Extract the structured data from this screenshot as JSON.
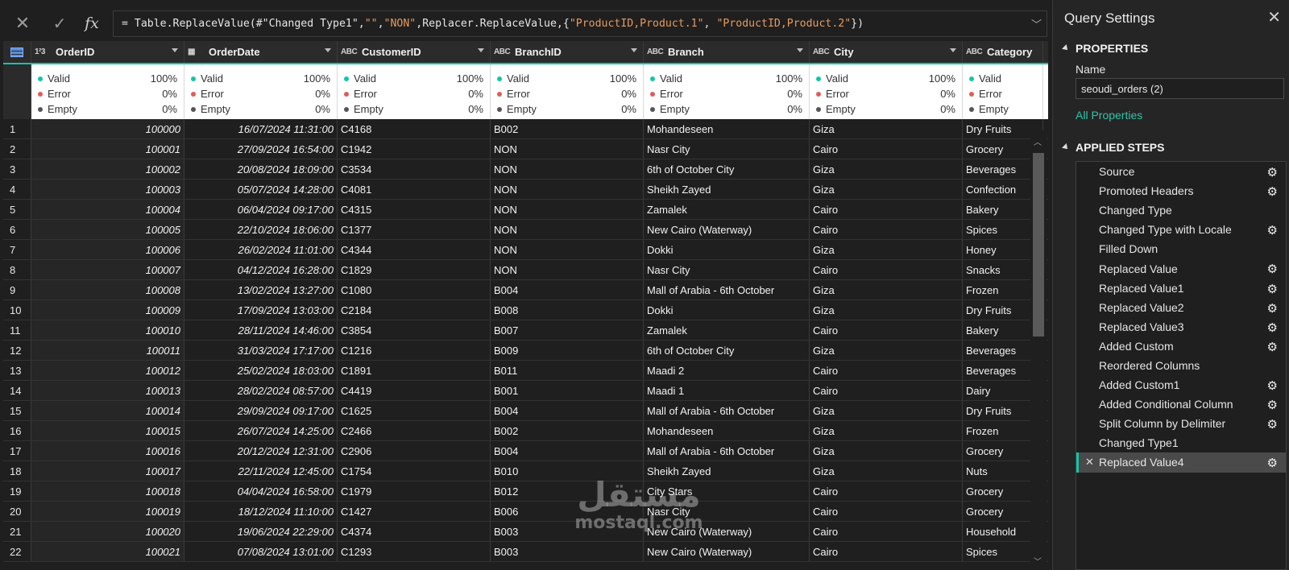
{
  "formula_bar": {
    "cancel_icon": "x-icon",
    "commit_icon": "check-icon",
    "fx_label": "fx",
    "formula_prefix": "= Table.ReplaceValue(#\"Changed Type1\",",
    "arg_old": "\"\"",
    "comma1": ",",
    "arg_new": "\"NON\"",
    "formula_mid": ",Replacer.ReplaceValue,{",
    "arg_col1": "\"ProductID,Product.1\"",
    "comma2": ", ",
    "arg_col2": "\"ProductID,Product.2\"",
    "formula_suffix": "})"
  },
  "columns": [
    {
      "type_icon": "1²3",
      "name": "OrderID"
    },
    {
      "type_icon": "▦",
      "name": "OrderDate"
    },
    {
      "type_icon": "ABC",
      "name": "CustomerID"
    },
    {
      "type_icon": "ABC",
      "name": "BranchID"
    },
    {
      "type_icon": "ABC",
      "name": "Branch"
    },
    {
      "type_icon": "ABC",
      "name": "City"
    },
    {
      "type_icon": "ABC",
      "name": "Category"
    }
  ],
  "quality": {
    "labels": [
      "Valid",
      "Error",
      "Empty"
    ],
    "values": [
      "100%",
      "0%",
      "0%"
    ],
    "colors": [
      "#14c4a9",
      "#e05b5b",
      "#555555"
    ]
  },
  "rows": [
    [
      "1",
      "100000",
      "16/07/2024 11:31:00",
      "C4168",
      "B002",
      "Mohandeseen",
      "Giza",
      "Dry Fruits"
    ],
    [
      "2",
      "100001",
      "27/09/2024 16:54:00",
      "C1942",
      "NON",
      "Nasr City",
      "Cairo",
      "Grocery"
    ],
    [
      "3",
      "100002",
      "20/08/2024 18:09:00",
      "C3534",
      "NON",
      "6th of October City",
      "Giza",
      "Beverages"
    ],
    [
      "4",
      "100003",
      "05/07/2024 14:28:00",
      "C4081",
      "NON",
      "Sheikh Zayed",
      "Giza",
      "Confection"
    ],
    [
      "5",
      "100004",
      "06/04/2024 09:17:00",
      "C4315",
      "NON",
      "Zamalek",
      "Cairo",
      "Bakery"
    ],
    [
      "6",
      "100005",
      "22/10/2024 18:06:00",
      "C1377",
      "NON",
      "New Cairo (Waterway)",
      "Cairo",
      "Spices"
    ],
    [
      "7",
      "100006",
      "26/02/2024 11:01:00",
      "C4344",
      "NON",
      "Dokki",
      "Giza",
      "Honey"
    ],
    [
      "8",
      "100007",
      "04/12/2024 16:28:00",
      "C1829",
      "NON",
      "Nasr City",
      "Cairo",
      "Snacks"
    ],
    [
      "9",
      "100008",
      "13/02/2024 13:27:00",
      "C1080",
      "B004",
      "Mall of Arabia - 6th October",
      "Giza",
      "Frozen"
    ],
    [
      "10",
      "100009",
      "17/09/2024 13:03:00",
      "C2184",
      "B008",
      "Dokki",
      "Giza",
      "Dry Fruits"
    ],
    [
      "11",
      "100010",
      "28/11/2024 14:46:00",
      "C3854",
      "B007",
      "Zamalek",
      "Cairo",
      "Bakery"
    ],
    [
      "12",
      "100011",
      "31/03/2024 17:17:00",
      "C1216",
      "B009",
      "6th of October City",
      "Giza",
      "Beverages"
    ],
    [
      "13",
      "100012",
      "25/02/2024 18:03:00",
      "C1891",
      "B011",
      "Maadi 2",
      "Cairo",
      "Beverages"
    ],
    [
      "14",
      "100013",
      "28/02/2024 08:57:00",
      "C4419",
      "B001",
      "Maadi 1",
      "Cairo",
      "Dairy"
    ],
    [
      "15",
      "100014",
      "29/09/2024 09:17:00",
      "C1625",
      "B004",
      "Mall of Arabia - 6th October",
      "Giza",
      "Dry Fruits"
    ],
    [
      "16",
      "100015",
      "26/07/2024 14:25:00",
      "C2466",
      "B002",
      "Mohandeseen",
      "Giza",
      "Frozen"
    ],
    [
      "17",
      "100016",
      "20/12/2024 12:31:00",
      "C2906",
      "B004",
      "Mall of Arabia - 6th October",
      "Giza",
      "Grocery"
    ],
    [
      "18",
      "100017",
      "22/11/2024 12:45:00",
      "C1754",
      "B010",
      "Sheikh Zayed",
      "Giza",
      "Nuts"
    ],
    [
      "19",
      "100018",
      "04/04/2024 16:58:00",
      "C1979",
      "B012",
      "City Stars",
      "Cairo",
      "Grocery"
    ],
    [
      "20",
      "100019",
      "18/12/2024 11:10:00",
      "C1427",
      "B006",
      "Nasr City",
      "Cairo",
      "Grocery"
    ],
    [
      "21",
      "100020",
      "19/06/2024 22:29:00",
      "C4374",
      "B003",
      "New Cairo (Waterway)",
      "Cairo",
      "Household"
    ],
    [
      "22",
      "100021",
      "07/08/2024 13:01:00",
      "C1293",
      "B003",
      "New Cairo (Waterway)",
      "Cairo",
      "Spices"
    ]
  ],
  "query_settings": {
    "title": "Query Settings",
    "close_icon": "close-icon",
    "properties_header": "PROPERTIES",
    "name_label": "Name",
    "name_value": "seoudi_orders (2)",
    "all_properties_link": "All Properties",
    "applied_steps_header": "APPLIED STEPS",
    "steps": [
      {
        "label": "Source",
        "gear": true
      },
      {
        "label": "Promoted Headers",
        "gear": true
      },
      {
        "label": "Changed Type",
        "gear": false
      },
      {
        "label": "Changed Type with Locale",
        "gear": true
      },
      {
        "label": "Filled Down",
        "gear": false
      },
      {
        "label": "Replaced Value",
        "gear": true
      },
      {
        "label": "Replaced Value1",
        "gear": true
      },
      {
        "label": "Replaced Value2",
        "gear": true
      },
      {
        "label": "Replaced Value3",
        "gear": true
      },
      {
        "label": "Added Custom",
        "gear": true
      },
      {
        "label": "Reordered Columns",
        "gear": false
      },
      {
        "label": "Added Custom1",
        "gear": true
      },
      {
        "label": "Added Conditional Column",
        "gear": true
      },
      {
        "label": "Split Column by Delimiter",
        "gear": true
      },
      {
        "label": "Changed Type1",
        "gear": false
      },
      {
        "label": "Replaced Value4",
        "gear": true,
        "active": true
      }
    ]
  },
  "watermark": {
    "arabic": "مستقل",
    "latin": "mostaql.com"
  },
  "accent_color": "#14c4a9"
}
